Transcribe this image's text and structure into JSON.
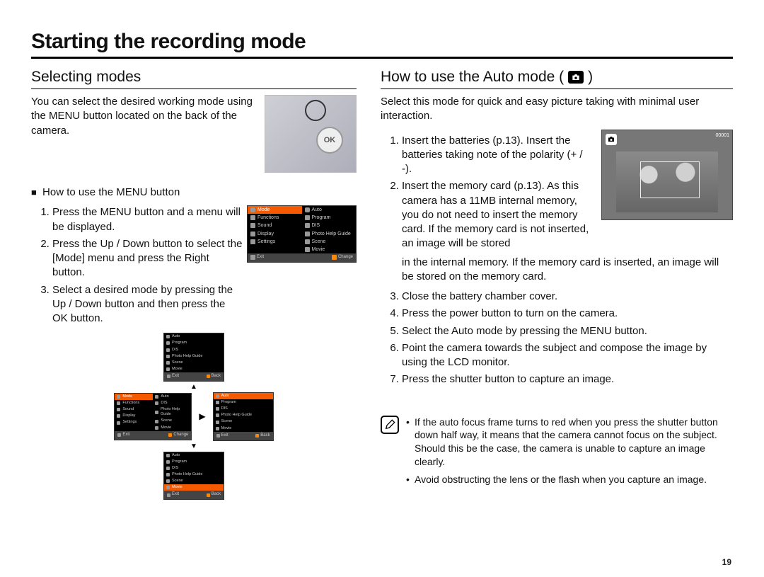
{
  "page_title": "Starting the recording mode",
  "page_number": "19",
  "left": {
    "heading": "Selecting modes",
    "intro": "You can select the desired working mode using the MENU button located on the back of the camera.",
    "sub_heading": "How to use the MENU button",
    "steps": [
      "Press the MENU button and a menu will be displayed.",
      "Press the Up / Down button to select the [Mode] menu and press the Right button.",
      "Select a desired mode by pressing the Up / Down button and then press the OK button."
    ],
    "menu_left": [
      "Mode",
      "Functions",
      "Sound",
      "Display",
      "Settings"
    ],
    "menu_right": [
      "Auto",
      "Program",
      "DIS",
      "Photo Help Guide",
      "Scene",
      "Movie"
    ],
    "menu_footer_left": "Exit",
    "menu_footer_right": "Change",
    "menu_footer_back": "Back",
    "selected_mode": "Mode",
    "selected_movie": "Movie"
  },
  "right": {
    "heading_prefix": "How to use the Auto mode (",
    "heading_suffix": " )",
    "intro": "Select this mode for quick and easy picture taking with minimal user interaction.",
    "steps_before_img": [
      "Insert the batteries (p.13). Insert the batteries taking note of the polarity (+ / -).",
      "Insert the memory card (p.13). As this camera has a 11MB internal memory, you do not need to insert the memory card. If the memory card is not inserted, an image will be stored"
    ],
    "step2_continuation": "in the internal memory. If the memory card is inserted, an image will be stored on the memory card.",
    "steps_after": [
      "Close the battery chamber cover.",
      "Press the power button to turn on the camera.",
      "Select the Auto mode by pressing the MENU button.",
      "Point the camera towards the subject and compose the image by using the LCD monitor.",
      "Press the shutter button to capture an image."
    ],
    "lcd_counter": "00001",
    "notes": [
      "If the auto focus frame turns to red when you press the shutter button down half way, it means that the camera cannot focus on the subject. Should this be the case, the camera is unable to capture an image clearly.",
      "Avoid obstructing the lens or the flash when you capture an image."
    ]
  }
}
